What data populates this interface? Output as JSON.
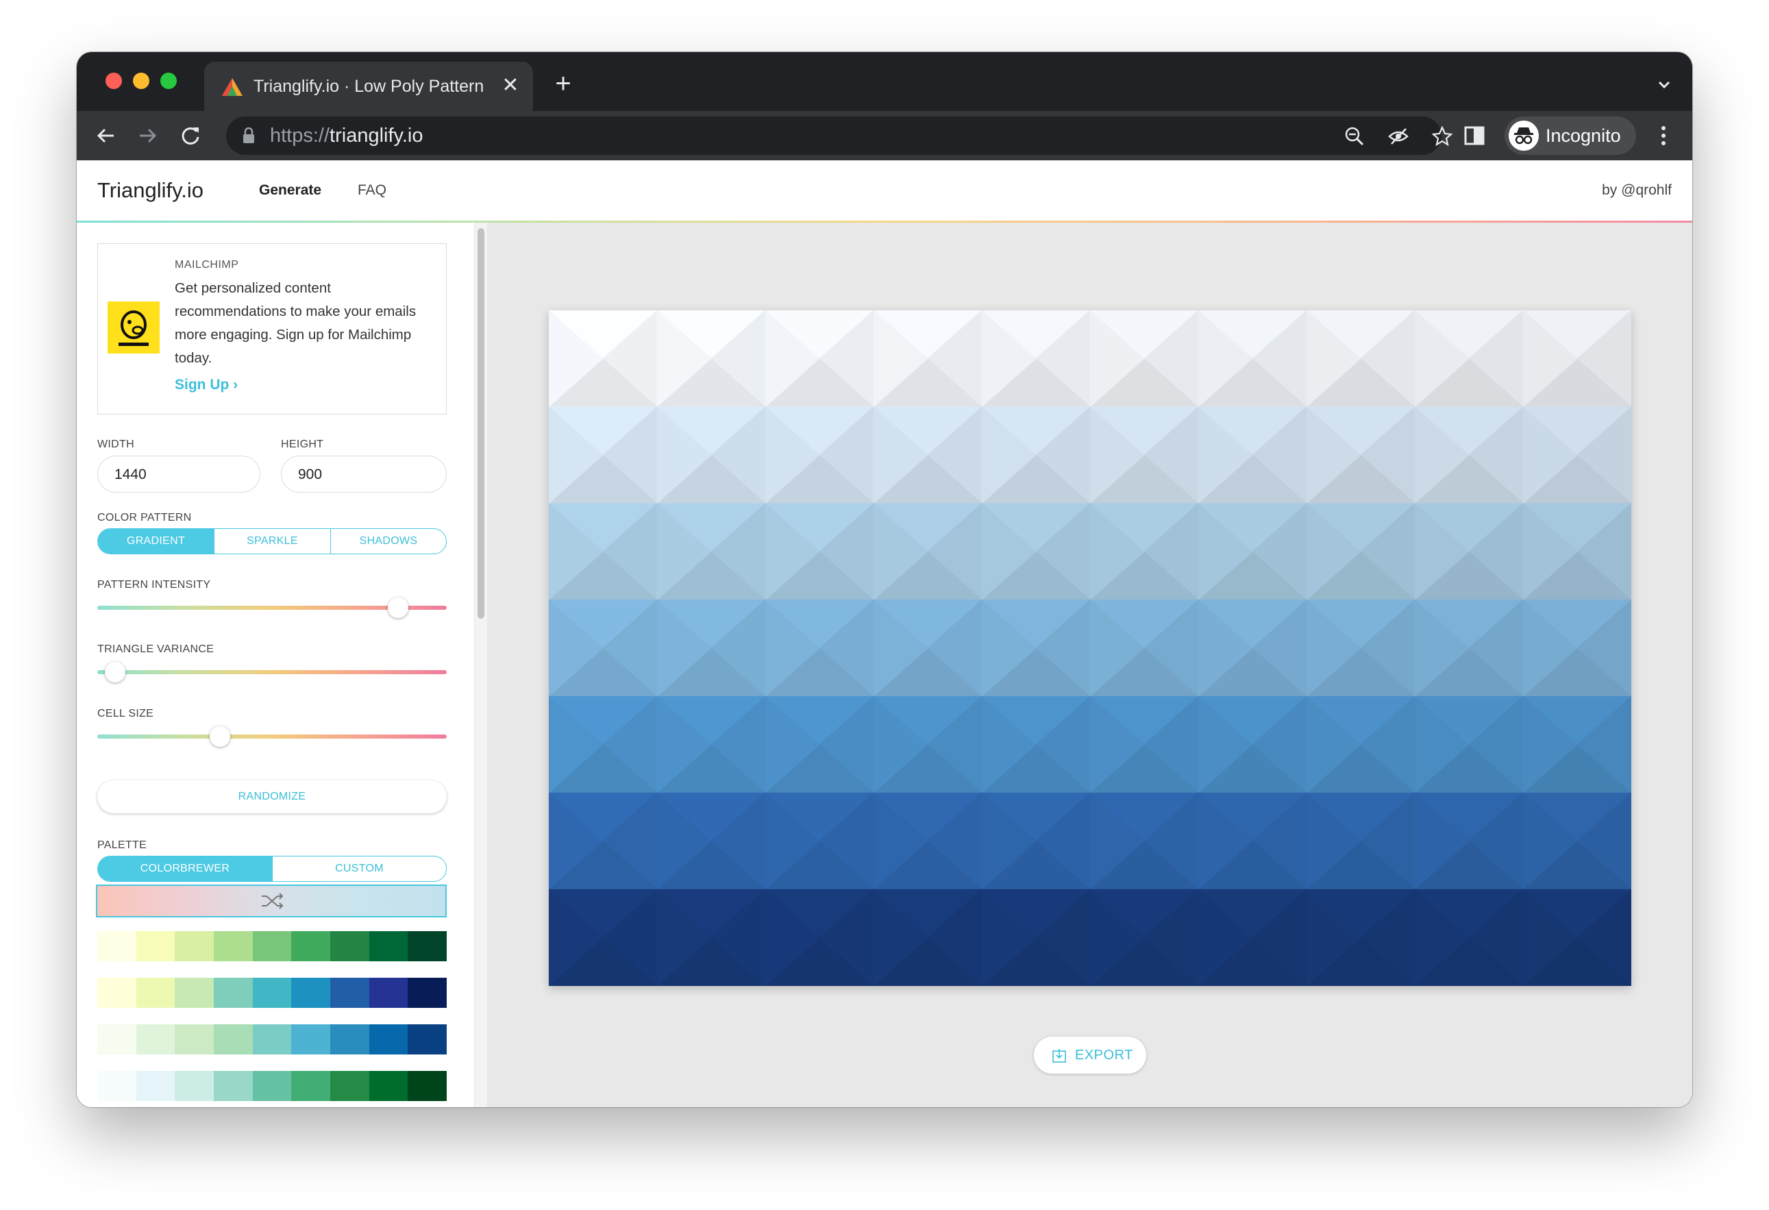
{
  "browser": {
    "tab_title": "Trianglify.io · Low Poly Pattern",
    "new_tab_symbol": "+",
    "close_symbol": "✕",
    "url_scheme": "https://",
    "url_host": "trianglify.io",
    "profile_name": "Incognito"
  },
  "header": {
    "brand": "Trianglify.io",
    "nav": [
      "Generate",
      "FAQ"
    ],
    "byline": "by @qrohlf"
  },
  "ad": {
    "source": "MAILCHIMP",
    "text": "Get personalized content recommendations to make your emails more engaging. Sign up for Mailchimp today.",
    "cta": "Sign Up ›",
    "brand_color": "#ffe01b"
  },
  "controls": {
    "width_label": "WIDTH",
    "width_value": "1440",
    "height_label": "HEIGHT",
    "height_value": "900",
    "color_pattern_label": "COLOR PATTERN",
    "color_pattern_options": [
      "GRADIENT",
      "SPARKLE",
      "SHADOWS"
    ],
    "color_pattern_selected": "GRADIENT",
    "pattern_intensity_label": "PATTERN INTENSITY",
    "pattern_intensity": 0.86,
    "triangle_variance_label": "TRIANGLE VARIANCE",
    "triangle_variance": 0.05,
    "cell_size_label": "CELL SIZE",
    "cell_size": 0.35,
    "randomize_label": "RANDOMIZE",
    "palette_label": "PALETTE",
    "palette_options": [
      "COLORBREWER",
      "CUSTOM"
    ],
    "palette_selected": "COLORBREWER"
  },
  "palettes": [
    [
      "#ffffe5",
      "#f7fcb9",
      "#d9f0a3",
      "#addd8e",
      "#78c679",
      "#41ab5d",
      "#238443",
      "#006837",
      "#004529"
    ],
    [
      "#ffffd9",
      "#edf8b1",
      "#c7e9b4",
      "#7fcdbb",
      "#41b6c4",
      "#1d91c0",
      "#225ea8",
      "#253494",
      "#081d58"
    ],
    [
      "#f7fcf0",
      "#e0f3db",
      "#ccebc5",
      "#a8ddb5",
      "#7bccc4",
      "#4eb3d3",
      "#2b8cbe",
      "#0868ac",
      "#084081"
    ],
    [
      "#f7fcfd",
      "#e5f5f9",
      "#ccece6",
      "#99d8c9",
      "#66c2a4",
      "#41ae76",
      "#238b45",
      "#006d2c",
      "#00441b"
    ]
  ],
  "pattern_colors": [
    "#f4f8fc",
    "#d6e5f3",
    "#aacde4",
    "#7fb5dc",
    "#4d93cc",
    "#2f68b0",
    "#183a7a"
  ],
  "export_label": "EXPORT",
  "colors": {
    "accent": "#45c8e0",
    "chrome_dark": "#202124",
    "chrome_toolbar": "#35363a"
  }
}
